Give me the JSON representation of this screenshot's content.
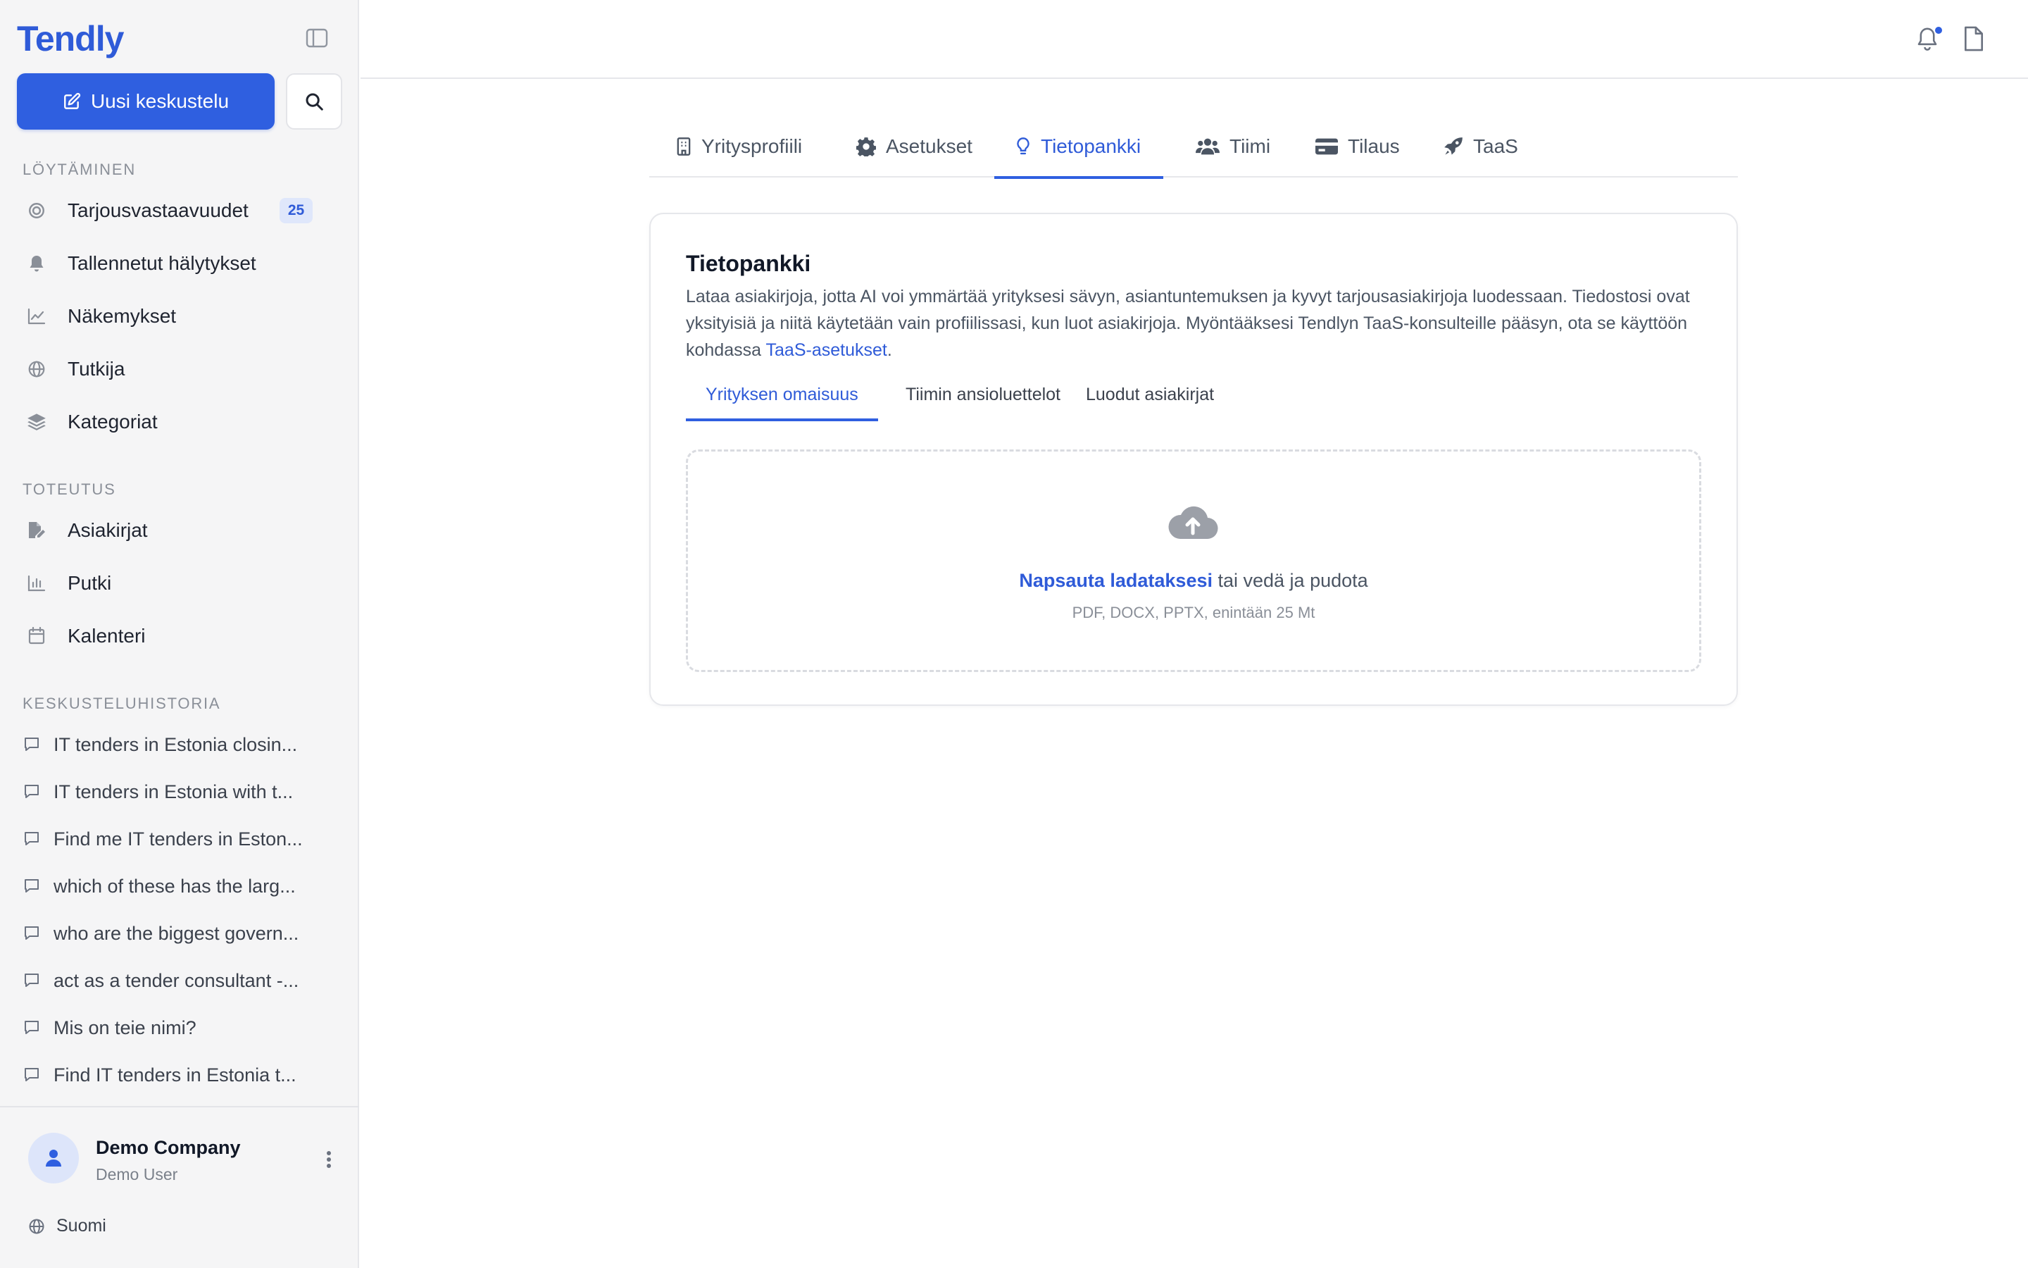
{
  "app": {
    "brand": "Tendly"
  },
  "sidebar": {
    "new_chat_label": "Uusi keskustelu",
    "sections": {
      "discovery": "LÖYTÄMINEN",
      "execution": "TOTEUTUS",
      "history": "KESKUSTELUHISTORIA"
    },
    "discovery_items": [
      {
        "label": "Tarjousvastaavuudet",
        "badge": "25",
        "icon": "target-icon"
      },
      {
        "label": "Tallennetut hälytykset",
        "icon": "bell-icon"
      },
      {
        "label": "Näkemykset",
        "icon": "line-chart-icon"
      },
      {
        "label": "Tutkija",
        "icon": "globe-icon"
      },
      {
        "label": "Kategoriat",
        "icon": "layers-icon"
      }
    ],
    "execution_items": [
      {
        "label": "Asiakirjat",
        "icon": "file-edit-icon"
      },
      {
        "label": "Putki",
        "icon": "bar-chart-icon"
      },
      {
        "label": "Kalenteri",
        "icon": "calendar-icon"
      }
    ],
    "history_items": [
      "IT tenders in Estonia closin...",
      "IT tenders in Estonia with t...",
      "Find me IT tenders in Eston...",
      "which of these has the larg...",
      "who are the biggest govern...",
      "act as a tender consultant -...",
      "Mis on teie nimi?",
      "Find IT tenders in Estonia t..."
    ],
    "user": {
      "company": "Demo Company",
      "name": "Demo User"
    },
    "language": "Suomi"
  },
  "tabs": [
    {
      "label": "Yritysprofiili",
      "icon": "building-icon"
    },
    {
      "label": "Asetukset",
      "icon": "gear-icon"
    },
    {
      "label": "Tietopankki",
      "icon": "lightbulb-icon",
      "active": true
    },
    {
      "label": "Tiimi",
      "icon": "users-icon"
    },
    {
      "label": "Tilaus",
      "icon": "credit-card-icon"
    },
    {
      "label": "TaaS",
      "icon": "rocket-icon"
    }
  ],
  "knowledge": {
    "title": "Tietopankki",
    "description": "Lataa asiakirjoja, jotta AI voi ymmärtää yrityksesi sävyn, asiantuntemuksen ja kyvyt tarjousasiakirjoja luodessaan. Tiedostosi ovat yksityisiä ja niitä käytetään vain profiilissasi, kun luot asiakirjoja. Myöntääksesi Tendlyn TaaS-konsulteille pääsyn, ota se käyttöön kohdassa",
    "description_link": "TaaS-asetukset",
    "description_end": ".",
    "subtabs": [
      "Yrityksen omaisuus",
      "Tiimin ansioluettelot",
      "Luodut asiakirjat"
    ],
    "upload": {
      "link_text": "Napsauta ladataksesi",
      "rest_text": " tai vedä ja pudota",
      "hint": "PDF, DOCX, PPTX, enintään 25 Mt"
    }
  },
  "colors": {
    "accent": "#2f5fe0",
    "sidebar_bg": "#f5f5f6",
    "border": "#e6e7eb"
  }
}
